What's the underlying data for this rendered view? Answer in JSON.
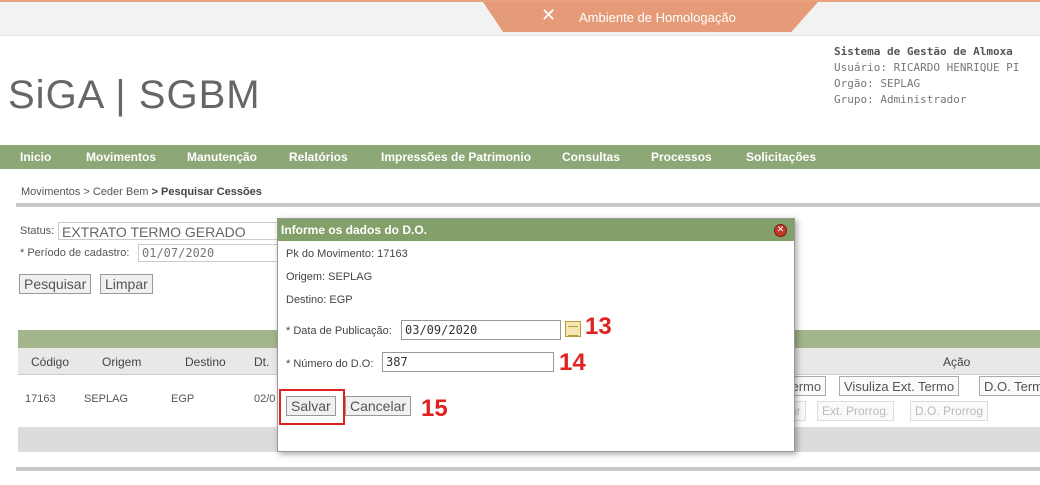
{
  "env": {
    "banner": "Ambiente de Homologação",
    "icon": "tools-icon"
  },
  "logo": "SiGA | SGBM",
  "system": {
    "title": "Sistema de Gestão de Almoxa",
    "user": "Usuário: RICARDO HENRIQUE PI",
    "org": "Orgão: SEPLAG",
    "group": "Grupo: Administrador"
  },
  "menu": [
    "Inicio",
    "Movimentos",
    "Manutenção",
    "Relatórios",
    "Impressões de Patrimonio",
    "Consultas",
    "Processos",
    "Solicitações"
  ],
  "breadcrumb": {
    "a": "Movimentos",
    "b": "> Ceder Bem",
    "c": "> Pesquisar Cessões"
  },
  "filters": {
    "status_label": "Status:",
    "status_value": "EXTRATO TERMO GERADO",
    "periodo_label": "* Período de cadastro:",
    "periodo_value": "01/07/2020",
    "search_btn": "Pesquisar",
    "clear_btn": "Limpar"
  },
  "table": {
    "headers": [
      "Código",
      "Origem",
      "Destino",
      "Dt.",
      "Ação"
    ],
    "row": {
      "codigo": "17163",
      "origem": "SEPLAG",
      "destino": "EGP",
      "dt": "02/0"
    },
    "actions": [
      "Termo",
      "Visuliza Ext. Termo",
      "D.O. Term"
    ],
    "actions_disabled": [
      "ar",
      "Ext. Prorrog.",
      "D.O. Prorrog"
    ]
  },
  "dialog": {
    "title": "Informe os dados do D.O.",
    "pk": "Pk do Movimento: 17163",
    "origem": "Origem: SEPLAG",
    "destino": "Destino: EGP",
    "data_label": "* Data de Publicação:",
    "data_value": "03/09/2020",
    "numero_label": "* Número do D.O:",
    "numero_value": "387",
    "save_btn": "Salvar",
    "cancel_btn": "Cancelar"
  },
  "annotations": [
    "13",
    "14",
    "15"
  ],
  "colors": {
    "menu": "#8ea776",
    "dialog_title": "#84a06a",
    "banner": "#e59a78",
    "annotation": "#e0211f"
  }
}
